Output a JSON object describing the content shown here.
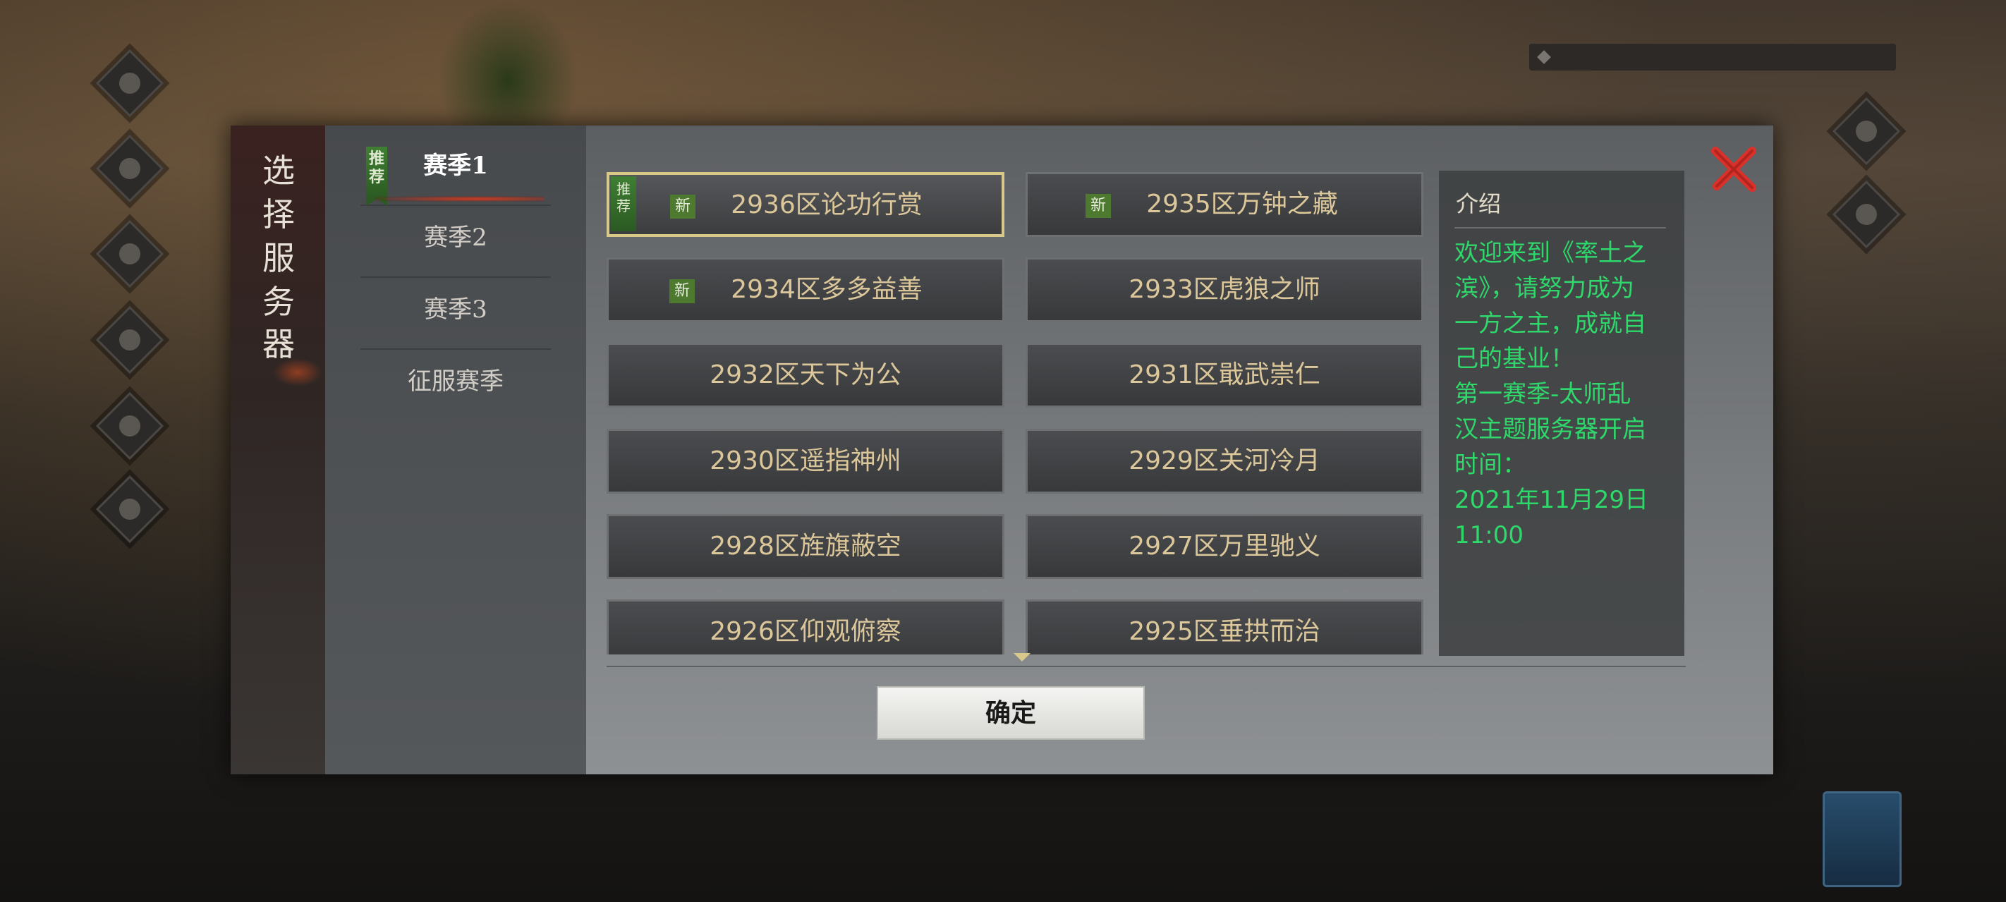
{
  "dialog": {
    "title_chars": [
      "选",
      "择",
      "服",
      "务",
      "器"
    ],
    "seasons": [
      {
        "label": "赛季1",
        "recommended": true,
        "active": true
      },
      {
        "label": "赛季2"
      },
      {
        "label": "赛季3"
      },
      {
        "label": "征服赛季"
      }
    ],
    "recommend_badge": "推荐",
    "new_badge": "新",
    "servers": [
      {
        "label": "2936区论功行赏",
        "is_new": true,
        "recommended": true,
        "selected": true
      },
      {
        "label": "2935区万钟之藏",
        "is_new": true
      },
      {
        "label": "2934区多多益善",
        "is_new": true
      },
      {
        "label": "2933区虎狼之师"
      },
      {
        "label": "2932区天下为公"
      },
      {
        "label": "2931区戢武崇仁"
      },
      {
        "label": "2930区遥指神州"
      },
      {
        "label": "2929区关河冷月"
      },
      {
        "label": "2928区旌旗蔽空"
      },
      {
        "label": "2927区万里驰义"
      },
      {
        "label": "2926区仰观俯察"
      },
      {
        "label": "2925区垂拱而治"
      }
    ],
    "intro": {
      "title": "介绍",
      "lines": [
        "欢迎来到《率土之",
        "滨》，请努力成为",
        "一方之主，成就自",
        "己的基业！",
        "第一赛季-太师乱",
        "汉主题服务器开启",
        "时间：",
        "2021年11月29日",
        "11:00"
      ]
    },
    "confirm_label": "确定"
  },
  "colors": {
    "intro_text": "#2fd86a",
    "server_text": "#dcc79a",
    "close_x": "#d8322a",
    "badge_green": "#4d7a2f"
  },
  "icons": {
    "close": "close-icon"
  }
}
